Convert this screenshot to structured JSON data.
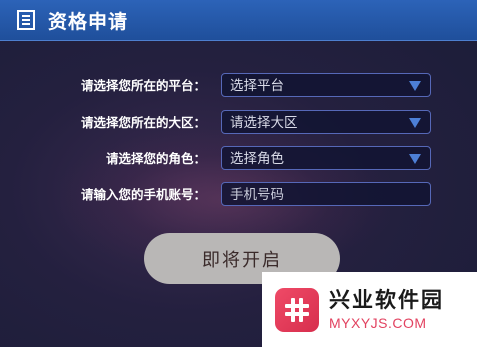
{
  "header": {
    "title": "资格申请",
    "icon": "document-icon"
  },
  "form": {
    "platform": {
      "label": "请选择您所在的平台：",
      "value": "选择平台"
    },
    "region": {
      "label": "请选择您所在的大区：",
      "value": "请选择大区"
    },
    "role": {
      "label": "请选择您的角色：",
      "value": "选择角色"
    },
    "phone": {
      "label": "请输入您的手机账号：",
      "placeholder": "手机号码"
    }
  },
  "submit_label": "即将开启",
  "watermark": {
    "cn": "兴业软件园",
    "en": "MYXYJS.COM",
    "logo": "hash-logo"
  },
  "colors": {
    "header": "#2c63b8",
    "accent": "#4d7fd6",
    "button": "#b9b7b6",
    "watermark_red": "#e24260"
  }
}
